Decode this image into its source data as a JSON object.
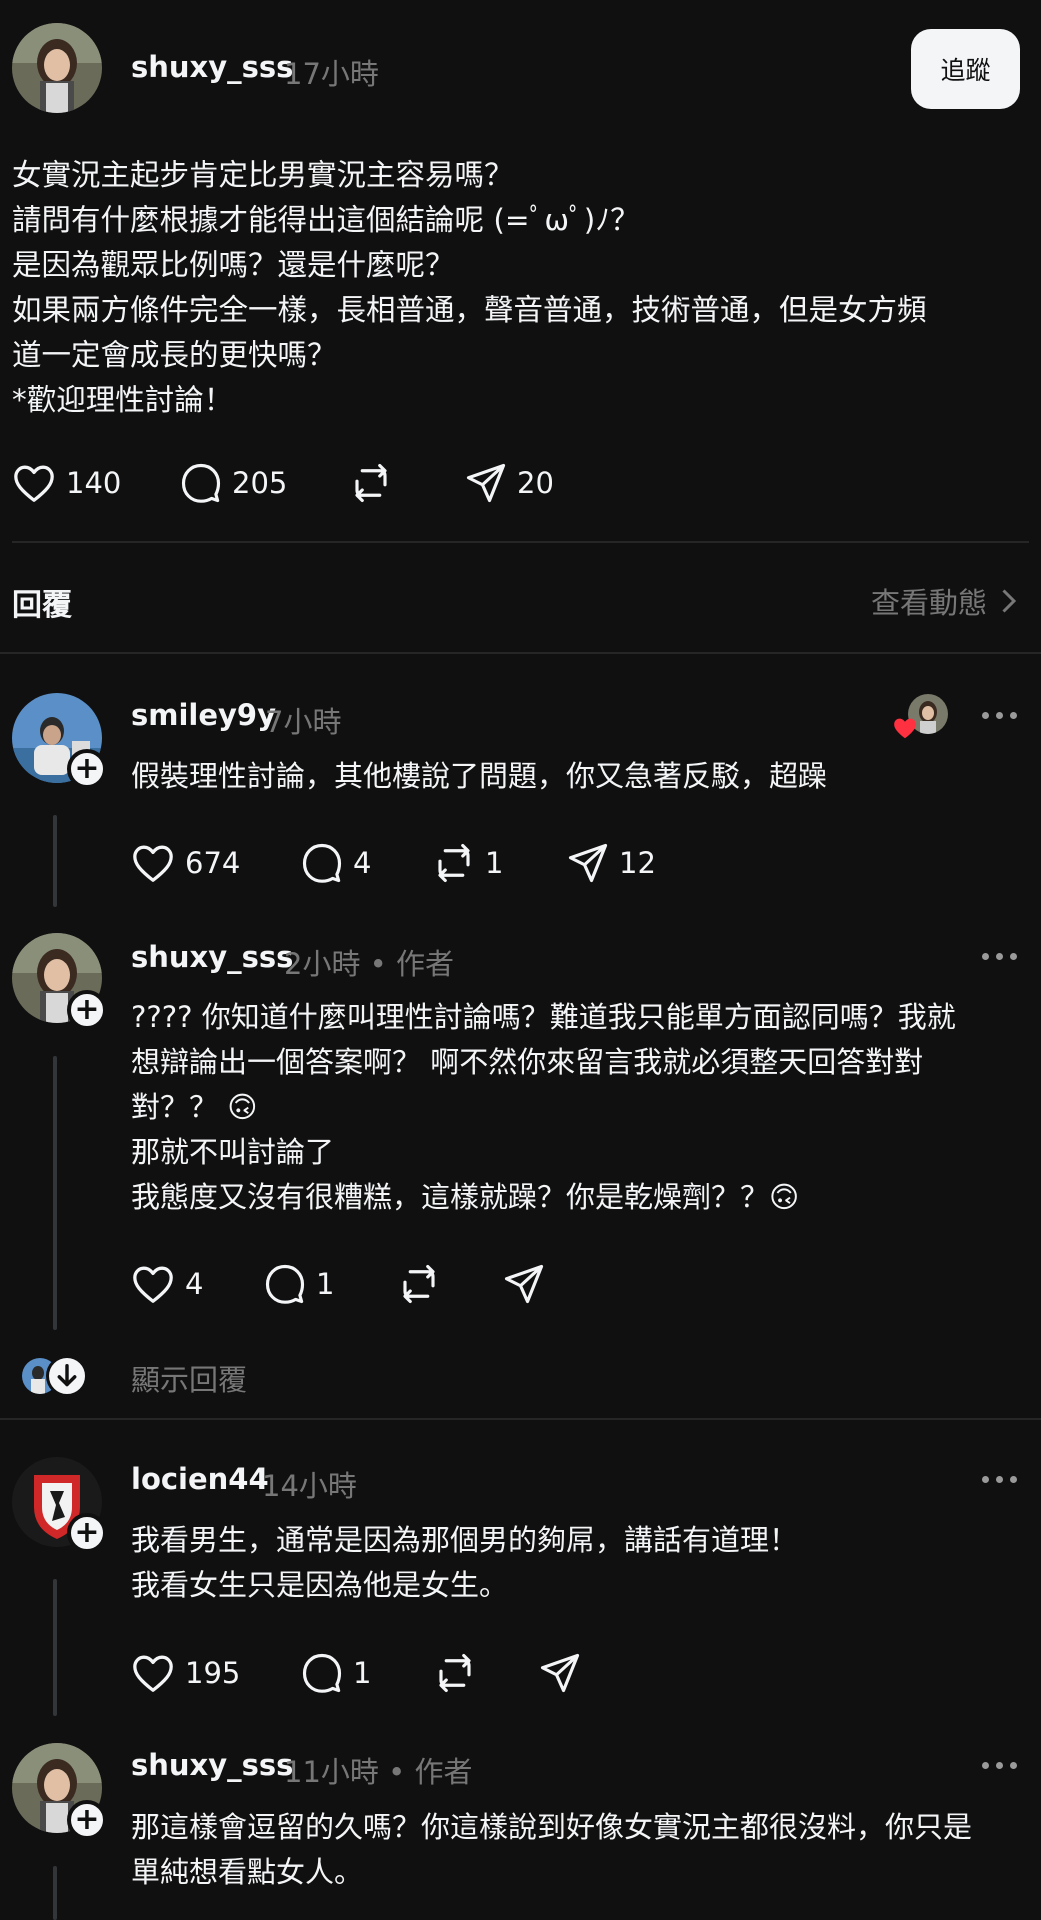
{
  "post": {
    "username": "shuxy_sss",
    "time": "17小時",
    "follow_label": "追蹤",
    "lines": [
      "女實況主起步肯定比男實況主容易嗎？",
      "請問有什麼根據才能得出這個結論呢 (=ﾟωﾟ)ﾉ？",
      "是因為觀眾比例嗎？還是什麼呢？",
      "如果兩方條件完全一樣，長相普通，聲音普通，技術普通，但是女方頻",
      "道一定會成長的更快嗎？",
      "*歡迎理性討論！"
    ],
    "likes": "140",
    "comments": "205",
    "shares": "20"
  },
  "replies_header": {
    "title": "回覆",
    "view_activity": "查看動態"
  },
  "replies": [
    {
      "username": "smiley9y",
      "time": "7小時",
      "text": "假裝理性討論，其他樓說了問題，你又急著反駁，超躁",
      "likes": "674",
      "comments": "4",
      "reposts": "1",
      "shares": "12"
    },
    {
      "username": "shuxy_sss",
      "time": "2小時 • 作者",
      "lines": [
        "???? 你知道什麼叫理性討論嗎？難道我只能單方面認同嗎？我就",
        "想辯論出一個答案啊？ 啊不然你來留言我就必須整天回答對對",
        "對？？ 🙃",
        "那就不叫討論了",
        "我態度又沒有很糟糕，這樣就躁？你是乾燥劑？？🙃"
      ],
      "likes": "4",
      "comments": "1",
      "show_replies": "顯示回覆"
    },
    {
      "username": "locien44",
      "time": "14小時",
      "lines": [
        "我看男生，通常是因為那個男的夠屌，講話有道理！",
        "我看女生只是因為他是女生。"
      ],
      "likes": "195",
      "comments": "1"
    },
    {
      "username": "shuxy_sss",
      "time": "11小時 • 作者",
      "lines": [
        "那這樣會逗留的久嗎？你這樣說到好像女實況主都很沒料，你只是",
        "單純想看點女人。"
      ]
    }
  ],
  "colors": {
    "background": "#101010",
    "text": "#f3f5f7",
    "muted": "#777777",
    "heart_red": "#ff3040"
  }
}
